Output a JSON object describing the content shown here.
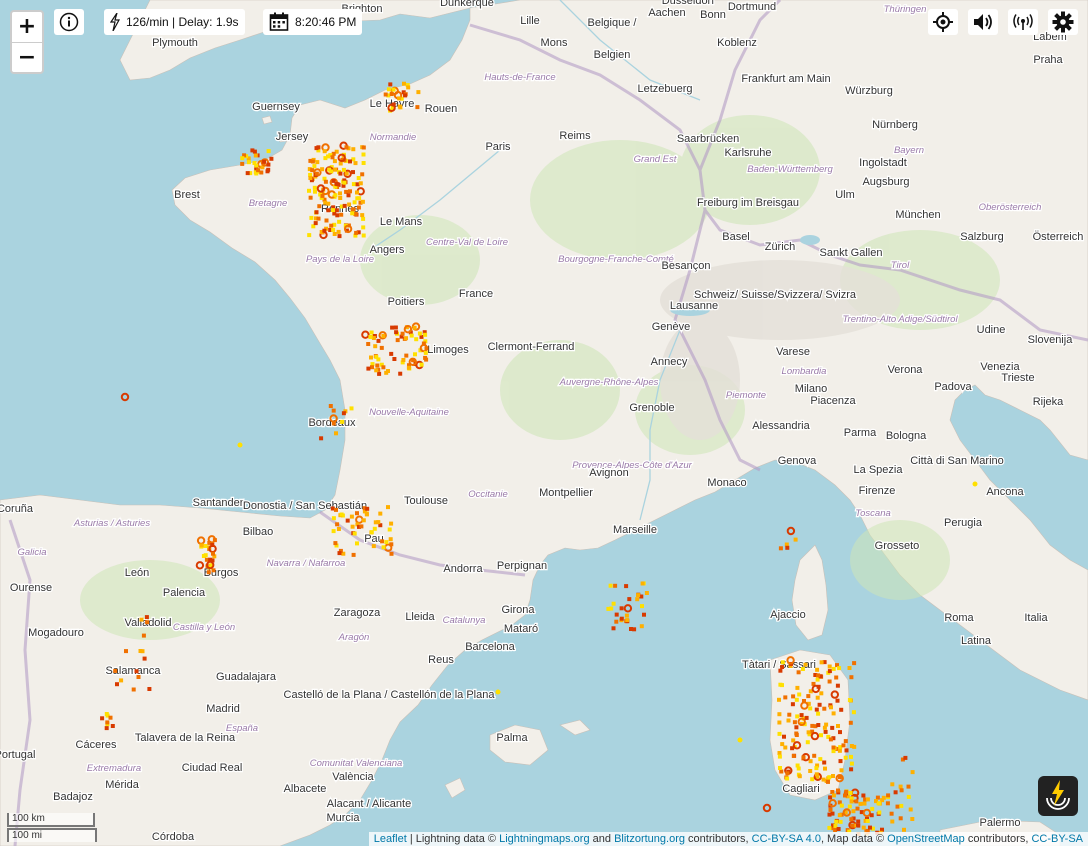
{
  "map": {
    "sea_color": "#aad3df",
    "land_color": "#f2efe9",
    "border_color": "#b49cc6",
    "lightning_colors": [
      "#ffe000",
      "#ffb000",
      "#f07000",
      "#d83a00"
    ],
    "labels": [
      {
        "text": "Brighton"
      },
      {
        "text": "Dunkerque"
      },
      {
        "text": "Düsseldorf"
      },
      {
        "text": "Dortmund"
      },
      {
        "text": "Plymouth"
      },
      {
        "text": "Lille"
      },
      {
        "text": "Mons"
      },
      {
        "text": "Belgique /"
      },
      {
        "text": "Belgien"
      },
      {
        "text": "Aachen"
      },
      {
        "text": "Bonn"
      },
      {
        "text": "Koblenz"
      },
      {
        "text": "Thüringen"
      },
      {
        "text": "Labem"
      },
      {
        "text": "Guernsey"
      },
      {
        "text": "Jersey"
      },
      {
        "text": "Le Havre"
      },
      {
        "text": "Rouen"
      },
      {
        "text": "Hauts-de-France"
      },
      {
        "text": "Frankfurt am Main"
      },
      {
        "text": "Praha"
      },
      {
        "text": "Letzebuerg"
      },
      {
        "text": "Würzburg"
      },
      {
        "text": "Normandie"
      },
      {
        "text": "Reims"
      },
      {
        "text": "Saarbrücken"
      },
      {
        "text": "Nürnberg"
      },
      {
        "text": "Paris"
      },
      {
        "text": "Grand Est"
      },
      {
        "text": "Karlsruhe"
      },
      {
        "text": "Bayern"
      },
      {
        "text": "Brest"
      },
      {
        "text": "Baden-Württemberg"
      },
      {
        "text": "Ingolstadt"
      },
      {
        "text": "Augsburg"
      },
      {
        "text": "Bretagne"
      },
      {
        "text": "Rennes"
      },
      {
        "text": "Freiburg im Breisgau"
      },
      {
        "text": "Ulm"
      },
      {
        "text": "Le Mans"
      },
      {
        "text": "München"
      },
      {
        "text": "Oberösterreich"
      },
      {
        "text": "Angers"
      },
      {
        "text": "Centre-Val de Loire"
      },
      {
        "text": "Basel"
      },
      {
        "text": "Zürich"
      },
      {
        "text": "Salzburg"
      },
      {
        "text": "Österreich"
      },
      {
        "text": "Pays de la Loire"
      },
      {
        "text": "Bourgogne-Franche-Comté"
      },
      {
        "text": "Sankt Gallen"
      },
      {
        "text": "Tirol"
      },
      {
        "text": "France"
      },
      {
        "text": "Besançon"
      },
      {
        "text": "Schweiz/ Suisse/Svizzera/ Svizra"
      },
      {
        "text": "Poitiers"
      },
      {
        "text": "Lausanne"
      },
      {
        "text": "Trentino-Alto Adige/Südtirol"
      },
      {
        "text": "Genève"
      },
      {
        "text": "Udine"
      },
      {
        "text": "Slovenija"
      },
      {
        "text": "Limoges"
      },
      {
        "text": "Clermont-Ferrand"
      },
      {
        "text": "Annecy"
      },
      {
        "text": "Varese"
      },
      {
        "text": "Lombardia"
      },
      {
        "text": "Milano"
      },
      {
        "text": "Verona"
      },
      {
        "text": "Venezia"
      },
      {
        "text": "Trieste"
      },
      {
        "text": "Auvergne-Rhône-Alpes"
      },
      {
        "text": "Padova"
      },
      {
        "text": "Rijeka"
      },
      {
        "text": "Bordeaux"
      },
      {
        "text": "Nouvelle-Aquitaine"
      },
      {
        "text": "Grenoble"
      },
      {
        "text": "Piemonte"
      },
      {
        "text": "Piacenza"
      },
      {
        "text": "Alessandria"
      },
      {
        "text": "Parma"
      },
      {
        "text": "Bologna"
      },
      {
        "text": "Città di San Marino"
      },
      {
        "text": "Provence-Alpes-Côte d'Azur"
      },
      {
        "text": "Avignon"
      },
      {
        "text": "Genova"
      },
      {
        "text": "La Spezia"
      },
      {
        "text": "Monaco"
      },
      {
        "text": "Firenze"
      },
      {
        "text": "Ancona"
      },
      {
        "text": "Santander"
      },
      {
        "text": "Donostia / San Sebastián"
      },
      {
        "text": "Toulouse"
      },
      {
        "text": "Occitanie"
      },
      {
        "text": "Montpellier"
      },
      {
        "text": "Marseille"
      },
      {
        "text": "Toscana"
      },
      {
        "text": "Perugia"
      },
      {
        "text": "Coruña"
      },
      {
        "text": "Asturias / Asturies"
      },
      {
        "text": "Bilbao"
      },
      {
        "text": "Pau"
      },
      {
        "text": "Galicia"
      },
      {
        "text": "Navarra / Nafarroa"
      },
      {
        "text": "Andorra"
      },
      {
        "text": "Perpignan"
      },
      {
        "text": "Grosseto"
      },
      {
        "text": "Burgos"
      },
      {
        "text": "León"
      },
      {
        "text": "Ourense"
      },
      {
        "text": "Palencia"
      },
      {
        "text": "Zaragoza"
      },
      {
        "text": "Girona"
      },
      {
        "text": "Ajaccio"
      },
      {
        "text": "Roma"
      },
      {
        "text": "Italia"
      },
      {
        "text": "Valladolid"
      },
      {
        "text": "Castilla y León"
      },
      {
        "text": "Aragón"
      },
      {
        "text": "Lleida"
      },
      {
        "text": "Catalunya"
      },
      {
        "text": "Mataró"
      },
      {
        "text": "Latina"
      },
      {
        "text": "Mogadouro"
      },
      {
        "text": "Barcelona"
      },
      {
        "text": "Reus"
      },
      {
        "text": "Tàtari / Sassari"
      },
      {
        "text": "Salamanca"
      },
      {
        "text": "Guadalajara"
      },
      {
        "text": "Castelló de la Plana / Castellón de la Plana"
      },
      {
        "text": "Madrid"
      },
      {
        "text": "España"
      },
      {
        "text": "Palma"
      },
      {
        "text": "Talavera de la Reina"
      },
      {
        "text": "Cáceres"
      },
      {
        "text": "Ciudad Real"
      },
      {
        "text": "Extremadura"
      },
      {
        "text": "Comunitat Valenciana"
      },
      {
        "text": "València"
      },
      {
        "text": "Mérida"
      },
      {
        "text": "Albacete"
      },
      {
        "text": "Badajoz"
      },
      {
        "text": "Alacant / Alicante"
      },
      {
        "text": "Murcia"
      },
      {
        "text": "Córdoba"
      },
      {
        "text": "Palermo"
      },
      {
        "text": "Cagliari"
      },
      {
        "text": "Portugal"
      }
    ]
  },
  "controls": {
    "zoom_in": "+",
    "zoom_out": "−",
    "info_icon": "info-icon",
    "strike_rate": "126/min | Delay: 1.9s",
    "clock": "8:20:46 PM",
    "locate_icon": "crosshair-icon",
    "sound_icon": "speaker-icon",
    "live_icon": "broadcast-icon",
    "settings_icon": "gear-icon"
  },
  "scale": {
    "km": "100 km",
    "mi": "100 mi"
  },
  "attribution": {
    "leaflet": "Leaflet",
    "sep1": " | Lightning data © ",
    "lm": "Lightningmaps.org",
    "and": " and ",
    "bo": "Blitzortung.org",
    "contrib": " contributors, ",
    "ccbysa4": "CC-BY-SA 4.0",
    "mapdata": ", Map data © ",
    "osm": "OpenStreetMap",
    "contrib2": " contributors, ",
    "ccbysa": "CC-BY-SA"
  }
}
